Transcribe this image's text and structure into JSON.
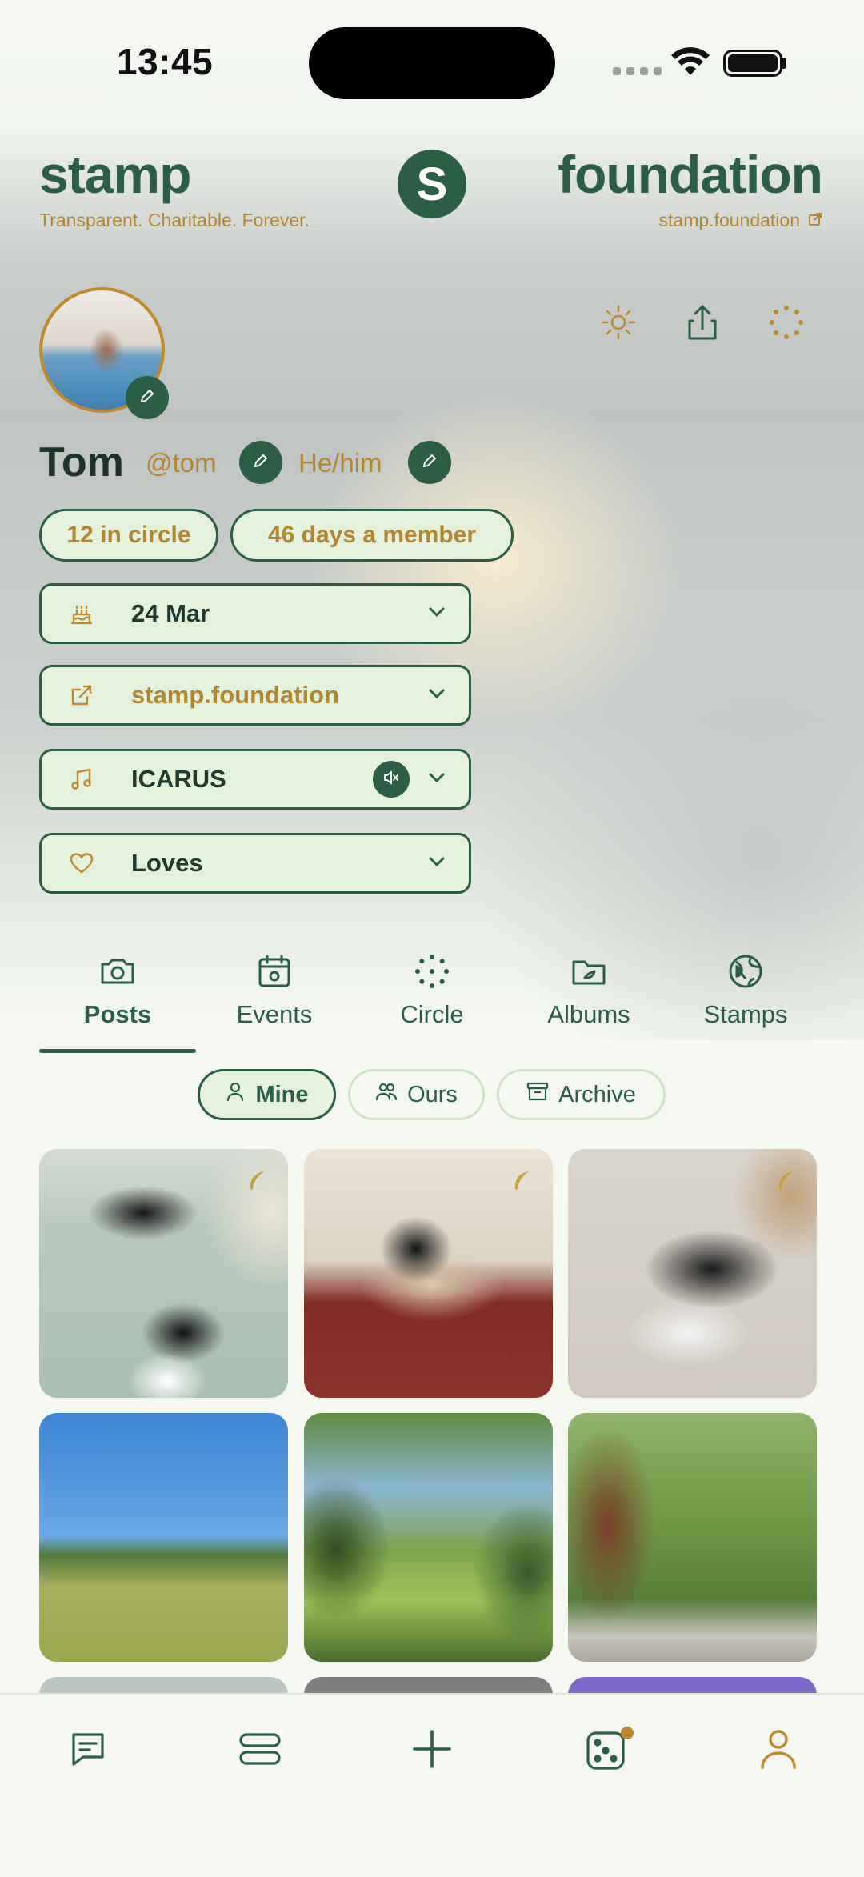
{
  "status": {
    "time": "13:45"
  },
  "brand": {
    "left": "stamp",
    "right": "foundation",
    "logo_letter": "S",
    "tagline": "Transparent. Charitable. Forever.",
    "link": "stamp.foundation"
  },
  "profile": {
    "name": "Tom",
    "handle": "@tom",
    "pronouns": "He/him",
    "circle_chip": "12 in circle",
    "member_chip": "46 days a member"
  },
  "fields": [
    {
      "label": "24 Mar",
      "icon": "cake-icon"
    },
    {
      "label": "stamp.foundation",
      "icon": "external-link-icon"
    },
    {
      "label": "ICARUS",
      "icon": "music-note-icon"
    },
    {
      "label": "Loves",
      "icon": "heart-icon"
    }
  ],
  "tabs": [
    {
      "label": "Posts",
      "icon": "camera-icon",
      "active": true
    },
    {
      "label": "Events",
      "icon": "calendar-icon"
    },
    {
      "label": "Circle",
      "icon": "dotted-circle-icon"
    },
    {
      "label": "Albums",
      "icon": "folder-icon"
    },
    {
      "label": "Stamps",
      "icon": "globe-icon"
    }
  ],
  "filters": [
    {
      "label": "Mine",
      "icon": "person-icon",
      "active": true
    },
    {
      "label": "Ours",
      "icon": "people-icon"
    },
    {
      "label": "Archive",
      "icon": "archive-icon"
    }
  ],
  "colors": {
    "primary": "#2a5e45",
    "accent": "#b4862e",
    "chip_bg": "#e4f2dc",
    "background": "#f4f8f1"
  },
  "nav": [
    "chat-icon",
    "feed-icon",
    "add-icon",
    "dice-icon",
    "profile-icon"
  ]
}
